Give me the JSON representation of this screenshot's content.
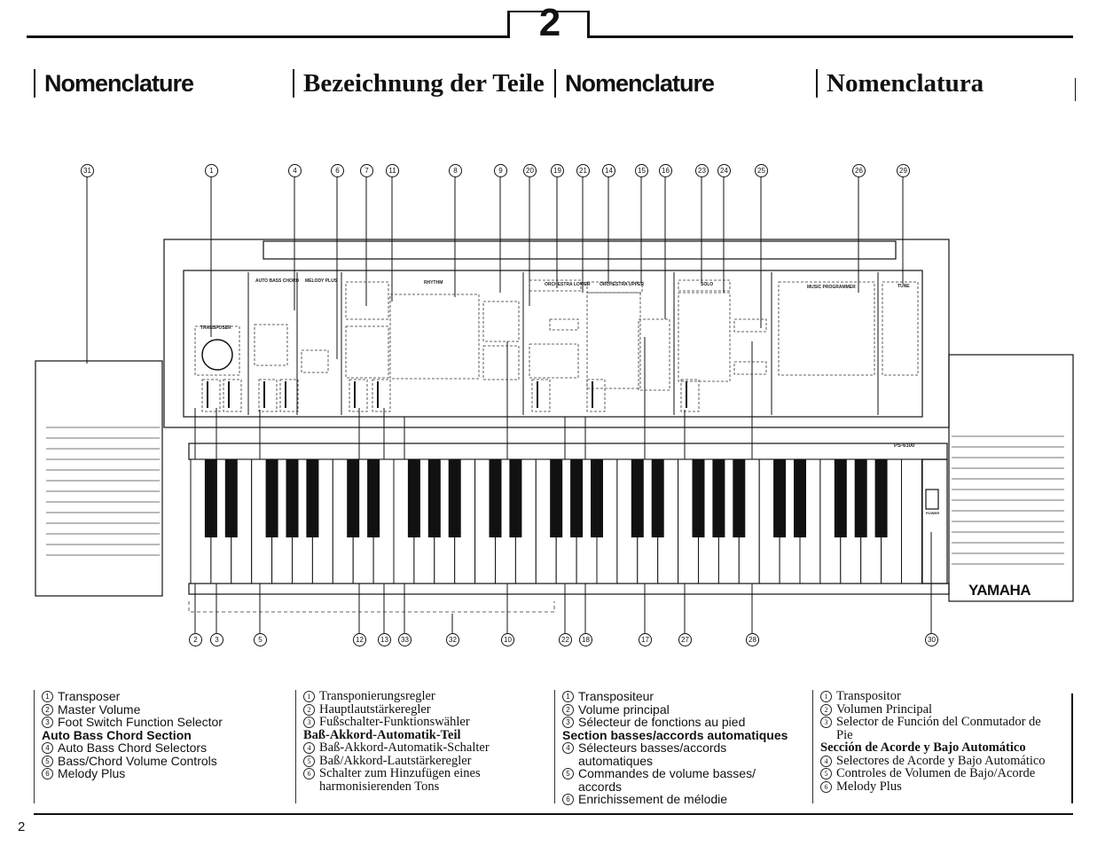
{
  "chapter_number": "2",
  "titles": [
    "Nomenclature",
    "Bezeichnung der Teile",
    "Nomenclature",
    "Nomenclatura"
  ],
  "diagram": {
    "callouts_top": [
      "31",
      "1",
      "4",
      "6",
      "7",
      "11",
      "8",
      "9",
      "20",
      "19",
      "21",
      "14",
      "15",
      "16",
      "23",
      "24",
      "25",
      "26",
      "29"
    ],
    "callouts_bottom": [
      "2",
      "3",
      "5",
      "12",
      "13",
      "33",
      "32",
      "10",
      "22",
      "18",
      "17",
      "27",
      "28",
      "30"
    ],
    "panel_labels": {
      "transposer": "TRANSPOSER",
      "auto_bass_chord": "AUTO BASS CHORD",
      "melody_plus": "MELODY PLUS",
      "rhythm": "RHYTHM",
      "orchestra_lower": "ORCHESTRA LOWER",
      "orchestra_upper": "ORCHESTRA UPPER",
      "solo": "SOLO",
      "music_programmer": "MUSIC PROGRAMMER",
      "tune": "TUNE",
      "power": "POWER",
      "model": "PS-6100"
    },
    "brand": "YAMAHA"
  },
  "columns": [
    {
      "items": [
        {
          "n": "1",
          "t": "Transposer"
        },
        {
          "n": "2",
          "t": "Master Volume"
        },
        {
          "n": "3",
          "t": "Foot Switch Function Selector"
        },
        {
          "h": "Auto Bass Chord Section"
        },
        {
          "n": "4",
          "t": "Auto Bass Chord Selectors"
        },
        {
          "n": "5",
          "t": "Bass/Chord Volume Controls"
        },
        {
          "n": "6",
          "t": "Melody Plus"
        }
      ]
    },
    {
      "items": [
        {
          "n": "1",
          "t": "Transponierungsregler"
        },
        {
          "n": "2",
          "t": "Hauptlautstärkeregler"
        },
        {
          "n": "3",
          "t": "Fußschalter-Funktionswähler"
        },
        {
          "h": "Baß-Akkord-Automatik-Teil"
        },
        {
          "n": "4",
          "t": "Baß-Akkord-Automatik-Schalter"
        },
        {
          "n": "5",
          "t": "Baß/Akkord-Lautstärkeregler"
        },
        {
          "n": "6",
          "t": "Schalter zum Hinzufügen eines\nharmonisierenden Tons"
        }
      ]
    },
    {
      "items": [
        {
          "n": "1",
          "t": "Transpositeur"
        },
        {
          "n": "2",
          "t": "Volume principal"
        },
        {
          "n": "3",
          "t": "Sélecteur de fonctions au pied"
        },
        {
          "h": "Section basses/accords automatiques"
        },
        {
          "n": "4",
          "t": "Sélecteurs basses/accords\nautomatiques"
        },
        {
          "n": "5",
          "t": "Commandes de volume basses/\naccords"
        },
        {
          "n": "6",
          "t": "Enrichissement de mélodie"
        }
      ]
    },
    {
      "items": [
        {
          "n": "1",
          "t": "Transpositor"
        },
        {
          "n": "2",
          "t": "Volumen Principal"
        },
        {
          "n": "3",
          "t": "Selector de Función del Conmutador de\nPie"
        },
        {
          "h": "Sección de Acorde y Bajo Automático"
        },
        {
          "n": "4",
          "t": "Selectores de Acorde y Bajo Automático"
        },
        {
          "n": "5",
          "t": "Controles de Volumen de Bajo/Acorde"
        },
        {
          "n": "6",
          "t": "Melody Plus"
        }
      ]
    }
  ],
  "page_number": "2"
}
